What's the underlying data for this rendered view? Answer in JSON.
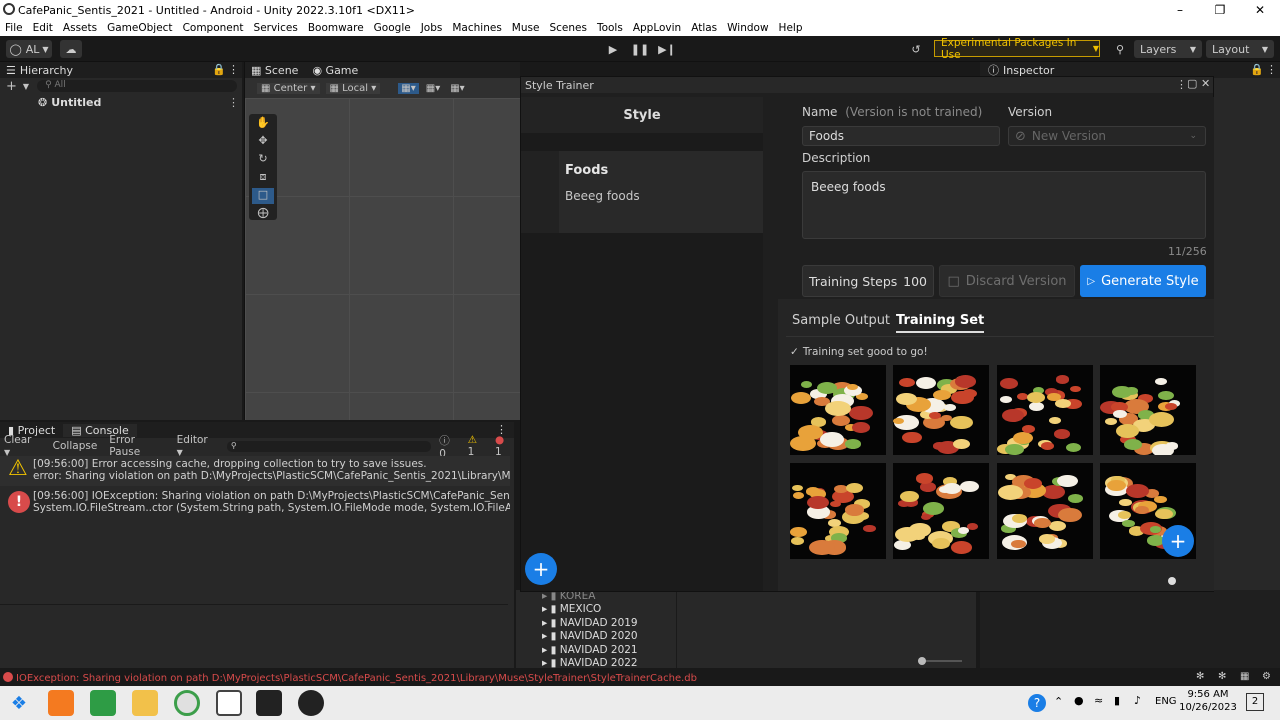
{
  "window": {
    "title": "CafePanic_Sentis_2021 - Untitled - Android - Unity 2022.3.10f1 <DX11>"
  },
  "menu": [
    "File",
    "Edit",
    "Assets",
    "GameObject",
    "Component",
    "Services",
    "Boomware",
    "Google",
    "Jobs",
    "Machines",
    "Muse",
    "Scenes",
    "Tools",
    "AppLovin",
    "Atlas",
    "Window",
    "Help"
  ],
  "toolbar": {
    "account": "AL",
    "experimental": "Experimental Packages In Use",
    "layers": "Layers",
    "layout": "Layout"
  },
  "hierarchy": {
    "title": "Hierarchy",
    "search_placeholder": "All",
    "scene": "Untitled"
  },
  "scene_tabs": {
    "scene": "Scene",
    "game": "Game",
    "center": "Center",
    "local": "Local"
  },
  "inspector": {
    "title": "Inspector"
  },
  "console": {
    "tabs": {
      "project": "Project",
      "console": "Console"
    },
    "toolbar": {
      "clear": "Clear",
      "collapse": "Collapse",
      "error_pause": "Error Pause",
      "editor": "Editor",
      "count_info": "0",
      "count_warn": "1",
      "count_err": "1"
    },
    "messages": [
      {
        "type": "warning",
        "line1": "[09:56:00] Error accessing cache, dropping collection to try to save issues.",
        "line2": "error: Sharing violation on path D:\\MyProjects\\PlasticSCM\\CafePanic_Sentis_2021\\Library\\Muse\\Sty"
      },
      {
        "type": "error",
        "line1": "[09:56:00] IOException: Sharing violation on path D:\\MyProjects\\PlasticSCM\\CafePanic_Sentis_202",
        "line2": "System.IO.FileStream..ctor (System.String path, System.IO.FileMode mode, System.IO.FileAccess ac"
      }
    ]
  },
  "project_folders": [
    "KOREA",
    "MEXICO",
    "NAVIDAD 2019",
    "NAVIDAD 2020",
    "NAVIDAD 2021",
    "NAVIDAD 2022"
  ],
  "style_trainer": {
    "title": "Style Trainer",
    "left_header": "Style",
    "style_name": "Foods",
    "style_desc": "Beeeg foods",
    "name_label": "Name",
    "name_hint": "(Version is not trained)",
    "name_value": "Foods",
    "version_label": "Version",
    "version_value": "New Version",
    "description_label": "Description",
    "description_value": "Beeeg foods",
    "char_count": "11/256",
    "training_steps_label": "Training Steps",
    "training_steps_value": "100",
    "discard_label": "Discard Version",
    "generate_label": "Generate Style",
    "tab_sample": "Sample Output",
    "tab_training": "Training Set",
    "status_text": "Training set good to go!"
  },
  "status_bar": {
    "text": "IOException: Sharing violation on path D:\\MyProjects\\PlasticSCM\\CafePanic_Sentis_2021\\Library\\Muse\\StyleTrainer\\StyleTrainerCache.db"
  },
  "taskbar": {
    "lang": "ENG",
    "time": "9:56 AM",
    "date": "10/26/2023",
    "notif": "2"
  },
  "colors": {
    "accent": "#1a7ee6",
    "warning": "#f0c200",
    "error": "#d84b4b"
  }
}
